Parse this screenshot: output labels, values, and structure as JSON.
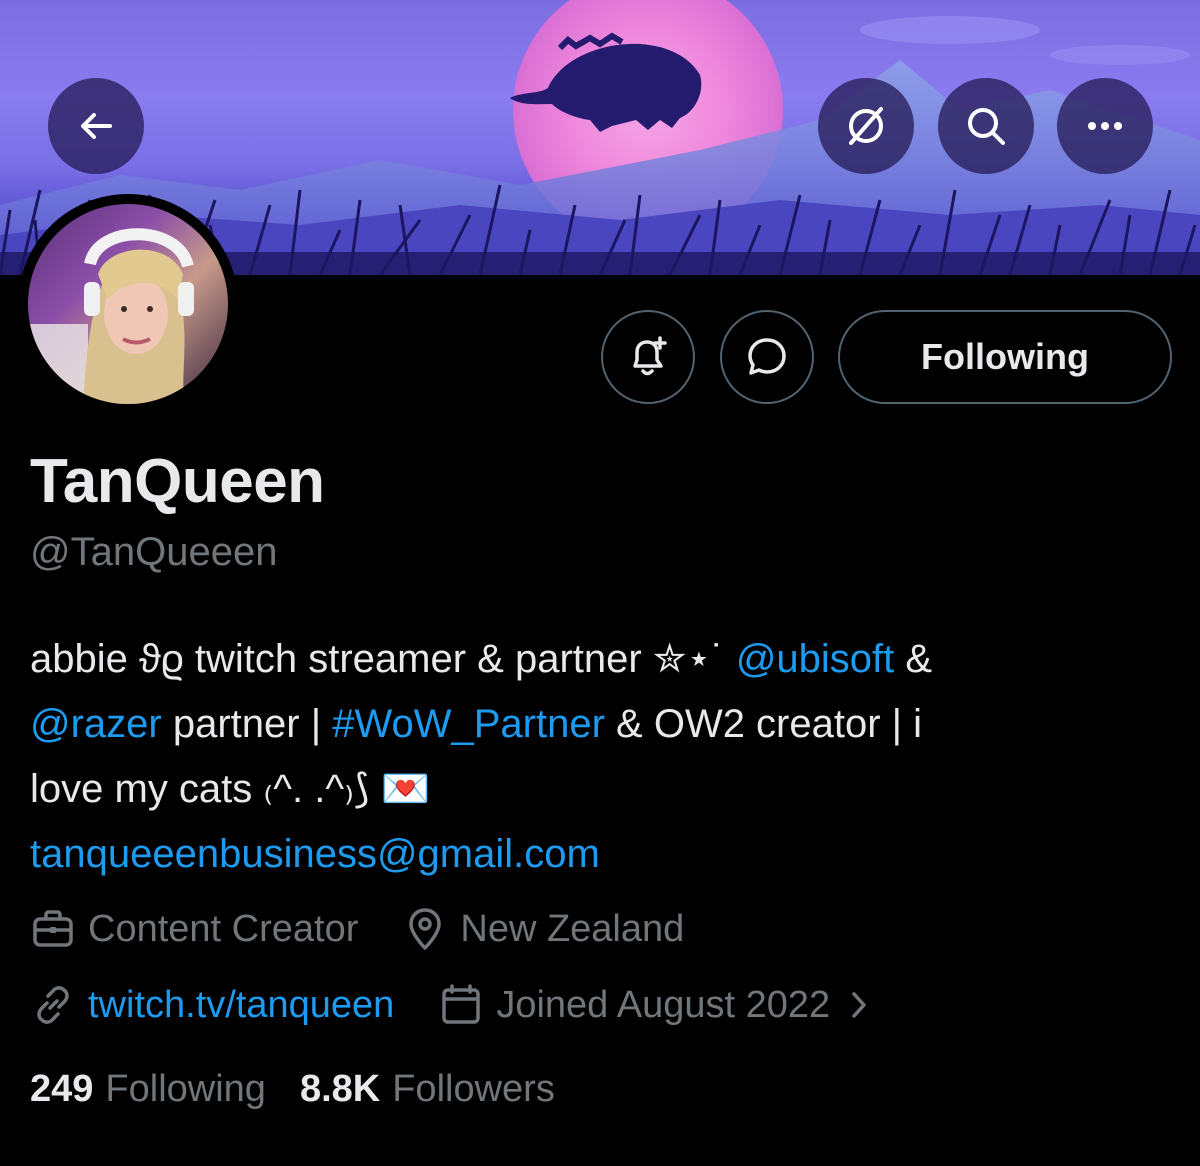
{
  "profile": {
    "name": "TanQueen",
    "handle": "@TanQueeen",
    "bio": {
      "line1_a": "abbie ϑϱ twitch streamer & partner ✮⋆˙ ",
      "line1_mention": "@ubisoft",
      "line1_b": " &",
      "line2_mention": "@razer",
      "line2_a": " partner | ",
      "line2_hashtag": "#WoW_Partner",
      "line2_b": " & OW2 creator | i",
      "line3": "love my cats ₍^. .^₎⟆ 💌",
      "email": "tanqueeenbusiness@gmail.com"
    },
    "category": "Content Creator",
    "location": "New Zealand",
    "website": "twitch.tv/tanqueen",
    "joined": "Joined August 2022",
    "following_count": "249",
    "following_label": "Following",
    "followers_count": "8.8K",
    "followers_label": "Followers"
  },
  "actions": {
    "follow_label": "Following"
  },
  "icons": {
    "back": "back-arrow-icon",
    "grok": "grok-icon",
    "search": "search-icon",
    "more": "more-icon",
    "notify": "notification-bell-plus-icon",
    "message": "message-icon",
    "briefcase": "briefcase-icon",
    "location": "location-pin-icon",
    "link": "link-icon",
    "calendar": "calendar-icon",
    "chevron": "chevron-right-icon"
  },
  "colors": {
    "background": "#000000",
    "link": "#1d9bf0",
    "secondary_text": "#71767b",
    "primary_text": "#e7e9ea"
  }
}
